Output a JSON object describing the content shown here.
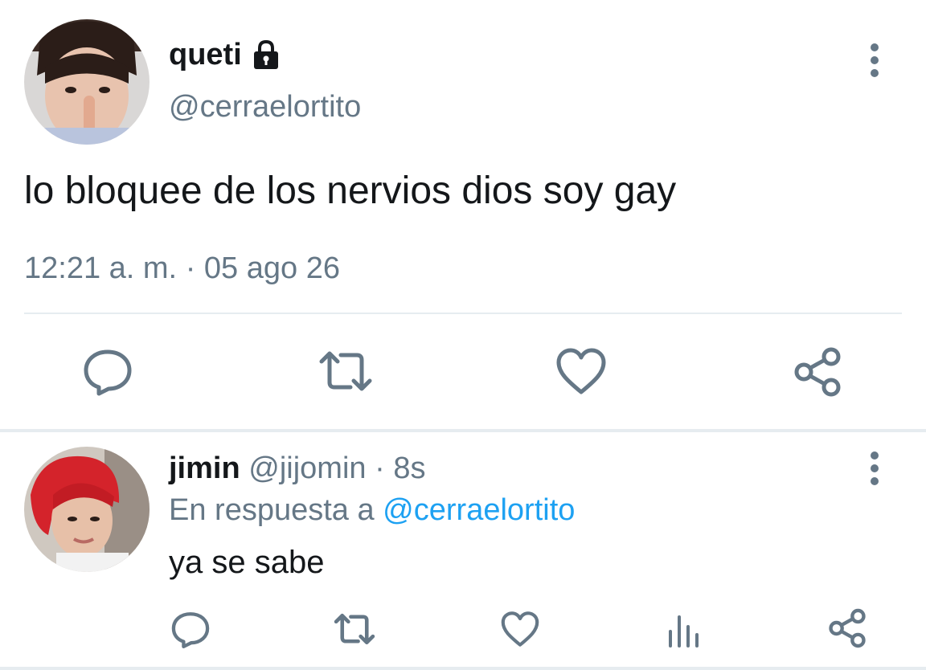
{
  "main_tweet": {
    "display_name": "queti",
    "handle": "@cerraelortito",
    "protected_icon": "lock-icon",
    "text": "lo bloquee de los nervios dios soy gay",
    "time": "12:21 a. m.",
    "separator": "·",
    "date": "05 ago 26",
    "actions": [
      "reply-icon",
      "retweet-icon",
      "like-icon",
      "share-icon"
    ]
  },
  "reply_tweet": {
    "display_name": "jimin",
    "handle": "@jijomin",
    "separator": "·",
    "age": "8s",
    "reply_context_prefix": "En respuesta a",
    "reply_context_handle": "@cerraelortito",
    "text": "ya se sabe",
    "actions": [
      "reply-icon",
      "retweet-icon",
      "like-icon",
      "analytics-icon",
      "share-icon"
    ]
  },
  "colors": {
    "text_primary": "#14171a",
    "text_secondary": "#657786",
    "link": "#1da1f2",
    "divider": "#e6ecf0",
    "icon": "#657786"
  }
}
